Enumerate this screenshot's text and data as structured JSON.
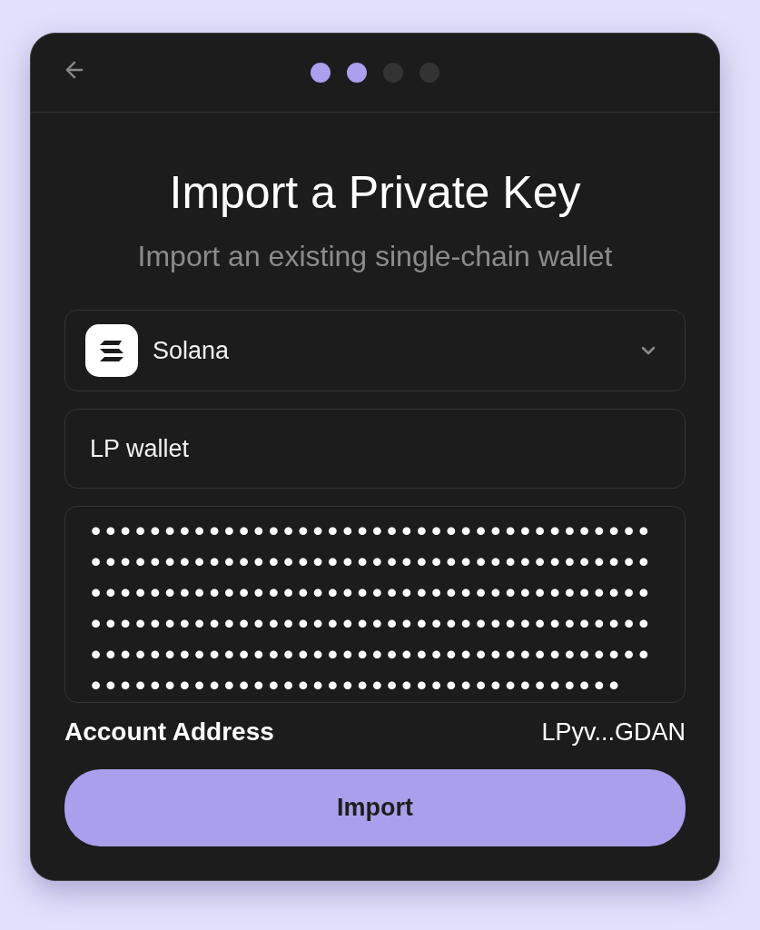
{
  "header": {
    "steps": [
      {
        "active": true
      },
      {
        "active": true
      },
      {
        "active": false
      },
      {
        "active": false
      }
    ]
  },
  "title": "Import a Private Key",
  "subtitle": "Import an existing single-chain wallet",
  "network_select": {
    "value": "Solana"
  },
  "wallet_name_field": {
    "value": "LP wallet"
  },
  "private_key_field": {
    "value": "••••••••••••••••••••••••••••••••••••••••••••••••••••••••••••••••••••••••••••••••••••••••••••••••••••••••••••••••••••••••••••••••••••••••••••••••••••••••••••••••••••••••••••••••••••••••••••••••••••••••••••••••••••••••••••••••••"
  },
  "account_address": {
    "label": "Account Address",
    "value": "LPyv...GDAN"
  },
  "import_button": {
    "label": "Import"
  }
}
